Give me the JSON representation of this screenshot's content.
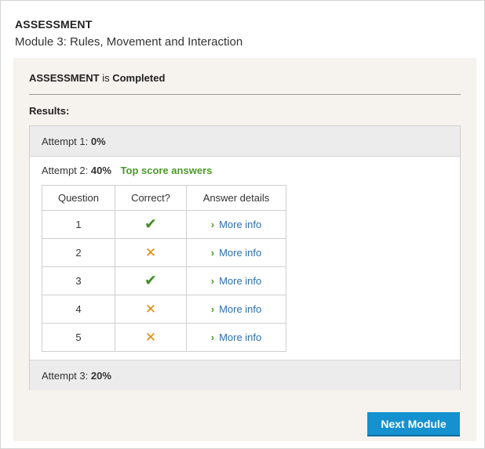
{
  "header": {
    "title": "ASSESSMENT",
    "subtitle": "Module 3: Rules, Movement and Interaction"
  },
  "status": {
    "subject": "ASSESSMENT",
    "connector": "is",
    "state": "Completed"
  },
  "results_label": "Results:",
  "attempts": [
    {
      "label": "Attempt 1:",
      "score": "0%"
    },
    {
      "label": "Attempt 2:",
      "score": "40%",
      "badge": "Top score answers"
    },
    {
      "label": "Attempt 3:",
      "score": "20%"
    }
  ],
  "table": {
    "headers": [
      "Question",
      "Correct?",
      "Answer details"
    ],
    "rows": [
      {
        "question": "1",
        "correct": true,
        "details": "More info"
      },
      {
        "question": "2",
        "correct": false,
        "details": "More info"
      },
      {
        "question": "3",
        "correct": true,
        "details": "More info"
      },
      {
        "question": "4",
        "correct": false,
        "details": "More info"
      },
      {
        "question": "5",
        "correct": false,
        "details": "More info"
      }
    ],
    "correct_glyph": "✔",
    "wrong_glyph": "✕",
    "chevron_glyph": "›"
  },
  "next_button": "Next Module",
  "colors": {
    "panel_bg": "#f6f2ee",
    "correct": "#3f8f22",
    "wrong": "#e58a0e",
    "link": "#2a6fb1",
    "button": "#1591cf",
    "top_score": "#4c9a2a"
  }
}
